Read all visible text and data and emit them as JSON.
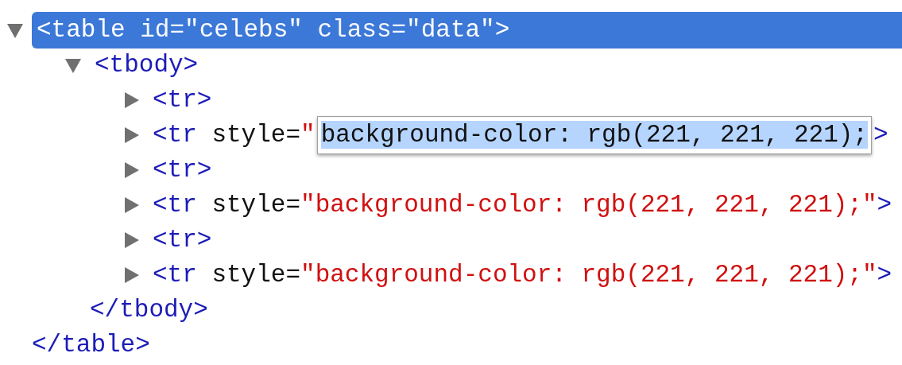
{
  "tree": [
    {
      "open": [
        {
          "kind": "tag",
          "text": "<table"
        },
        {
          "kind": "attr-name",
          "text": " id="
        },
        {
          "kind": "attr-value",
          "text": "\"celebs\""
        },
        {
          "kind": "attr-name",
          "text": " class="
        },
        {
          "kind": "attr-value",
          "text": "\"data\""
        },
        {
          "kind": "tag",
          "text": ">"
        }
      ],
      "expanded": true,
      "selected": true,
      "close": "</table>",
      "children": [
        {
          "open": [
            {
              "kind": "tag",
              "text": "<tbody>"
            }
          ],
          "expanded": true,
          "selected": false,
          "close": "</tbody>",
          "children": [
            {
              "open": [
                {
                  "kind": "tag",
                  "text": "<tr>"
                }
              ],
              "expanded": false,
              "selected": false
            },
            {
              "open": [
                {
                  "kind": "tag",
                  "text": "<tr"
                },
                {
                  "kind": "attr-name",
                  "text": " style="
                },
                {
                  "kind": "attr-value",
                  "text": "\""
                },
                {
                  "kind": "editor",
                  "text": "background-color: rgb(221, 221, 221);"
                },
                {
                  "kind": "tag",
                  "text": ">"
                }
              ],
              "expanded": false,
              "selected": false
            },
            {
              "open": [
                {
                  "kind": "tag",
                  "text": "<tr>"
                }
              ],
              "expanded": false,
              "selected": false
            },
            {
              "open": [
                {
                  "kind": "tag",
                  "text": "<tr"
                },
                {
                  "kind": "attr-name",
                  "text": " style="
                },
                {
                  "kind": "attr-value",
                  "text": "\"background-color: rgb(221, 221, 221);\""
                },
                {
                  "kind": "tag",
                  "text": ">"
                }
              ],
              "expanded": false,
              "selected": false
            },
            {
              "open": [
                {
                  "kind": "tag",
                  "text": "<tr>"
                }
              ],
              "expanded": false,
              "selected": false
            },
            {
              "open": [
                {
                  "kind": "tag",
                  "text": "<tr"
                },
                {
                  "kind": "attr-name",
                  "text": " style="
                },
                {
                  "kind": "attr-value",
                  "text": "\"background-color: rgb(221, 221, 221);\""
                },
                {
                  "kind": "tag",
                  "text": ">"
                }
              ],
              "expanded": false,
              "selected": false
            }
          ]
        }
      ]
    }
  ]
}
